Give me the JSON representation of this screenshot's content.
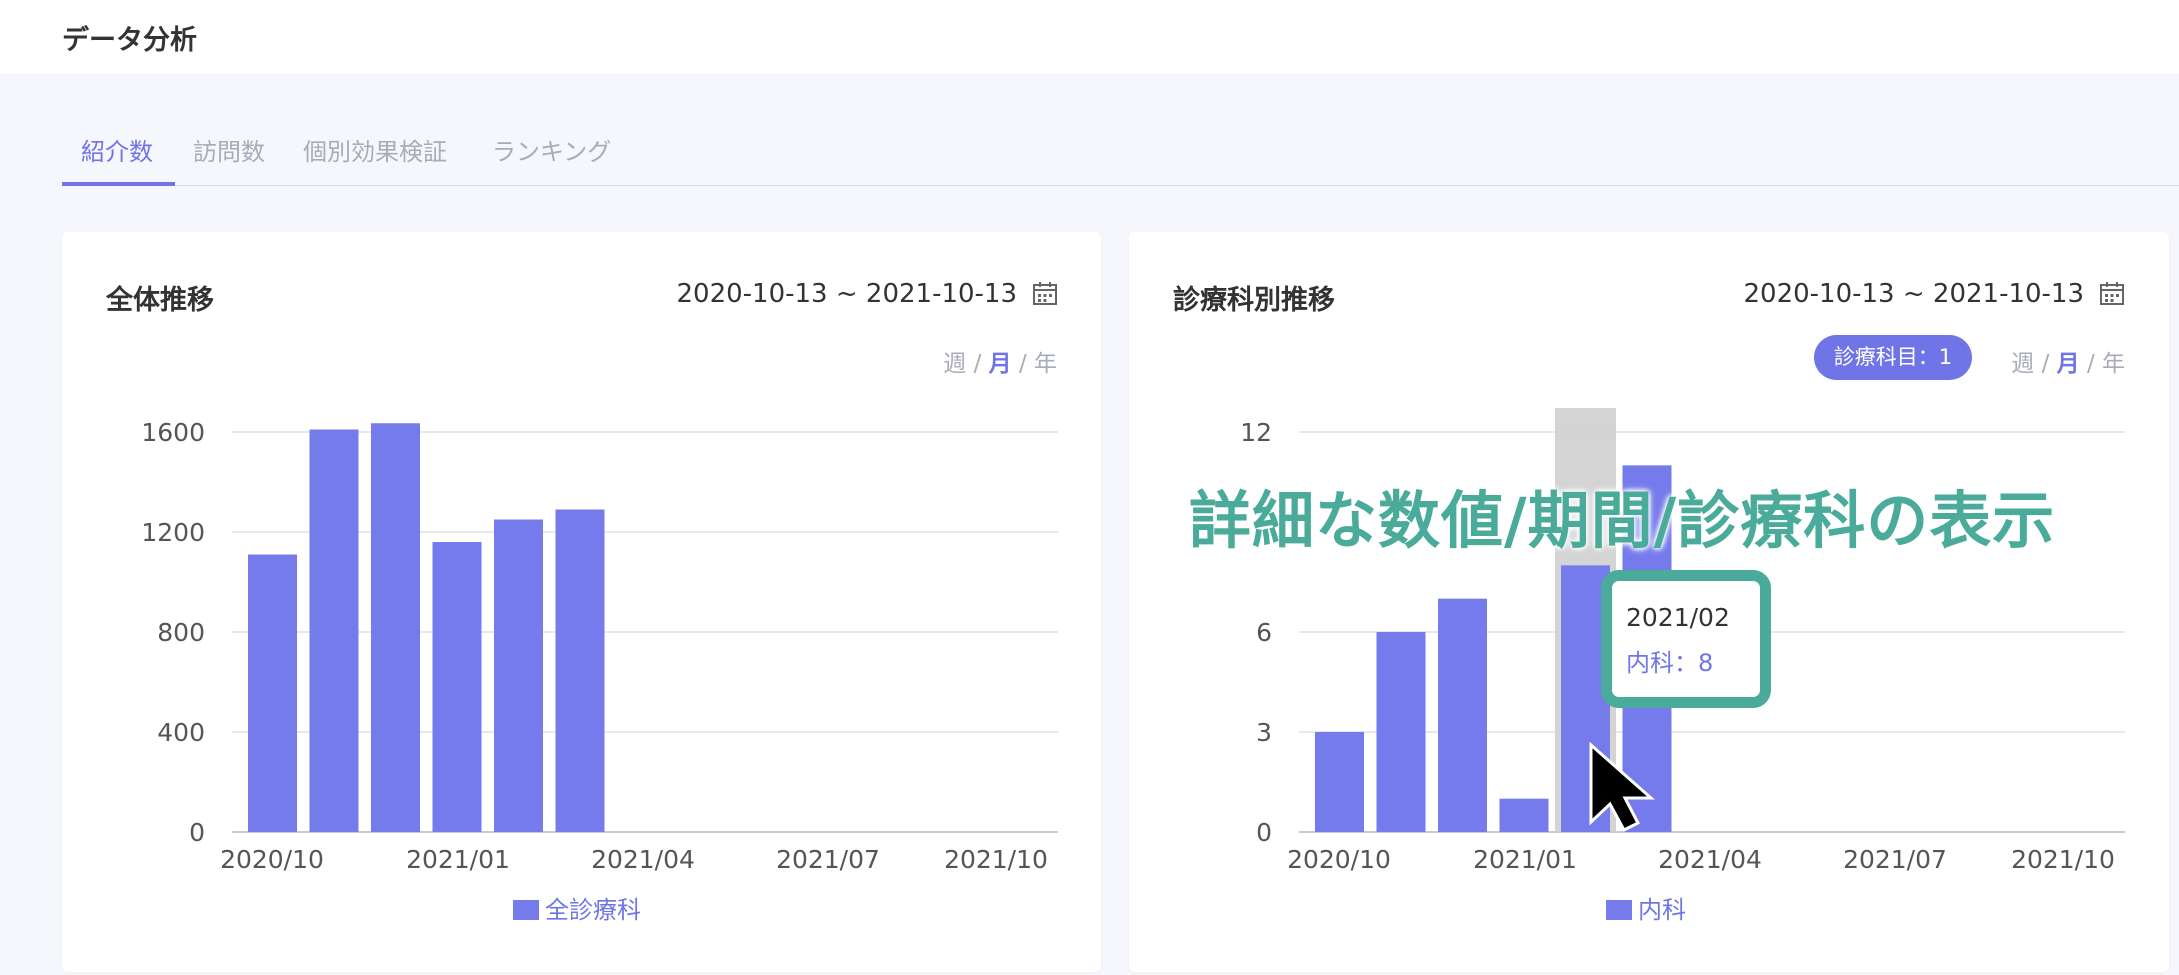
{
  "header": {
    "title": "データ分析"
  },
  "tabs": [
    {
      "label": "紹介数",
      "active": true
    },
    {
      "label": "訪問数",
      "active": false
    },
    {
      "label": "個別効果検証",
      "active": false
    },
    {
      "label": "ランキング",
      "active": false
    }
  ],
  "colors": {
    "accent": "#6f75e6",
    "bar": "#767bec",
    "highlight": "#4aab9b",
    "hover_band": "#cccccc"
  },
  "icons": {
    "date_picker": "calendar-icon",
    "pointer": "mouse-cursor-icon"
  },
  "period_options": {
    "week": "週",
    "month": "月",
    "year": "年",
    "separator": "/",
    "selected": "月"
  },
  "overall_card": {
    "title": "全体推移",
    "date_range": "2020-10-13 ~ 2021-10-13",
    "legend": "全診療科"
  },
  "department_card": {
    "title": "診療科別推移",
    "date_range": "2020-10-13 ~ 2021-10-13",
    "filter_pill": "診療科目：1",
    "legend": "内科"
  },
  "overlay": {
    "caption": "詳細な数値/期間/診療科の表示",
    "tooltip_date": "2021/02",
    "tooltip_value": "内科：8"
  },
  "chart_data": [
    {
      "type": "bar",
      "title": "全体推移",
      "categories": [
        "2020/10",
        "2020/11",
        "2020/12",
        "2021/01",
        "2021/02",
        "2021/03",
        "2021/04",
        "2021/05",
        "2021/06",
        "2021/07",
        "2021/08",
        "2021/09",
        "2021/10"
      ],
      "x_tick_labels": [
        "2020/10",
        "2021/01",
        "2021/04",
        "2021/07",
        "2021/10"
      ],
      "series": [
        {
          "name": "全診療科",
          "values": [
            1110,
            1610,
            1635,
            1160,
            1250,
            1290,
            null,
            null,
            null,
            null,
            null,
            null,
            null
          ]
        }
      ],
      "y_ticks": [
        0,
        400,
        800,
        1200,
        1600
      ],
      "ylim": [
        0,
        1600
      ],
      "grid": true,
      "legend_position": "bottom"
    },
    {
      "type": "bar",
      "title": "診療科別推移",
      "categories": [
        "2020/10",
        "2020/11",
        "2020/12",
        "2021/01",
        "2021/02",
        "2021/03",
        "2021/04",
        "2021/05",
        "2021/06",
        "2021/07",
        "2021/08",
        "2021/09",
        "2021/10"
      ],
      "x_tick_labels": [
        "2020/10",
        "2021/01",
        "2021/04",
        "2021/07",
        "2021/10"
      ],
      "series": [
        {
          "name": "内科",
          "values": [
            3,
            6,
            7,
            1,
            8,
            11,
            null,
            null,
            null,
            null,
            null,
            null,
            null
          ]
        }
      ],
      "y_ticks": [
        0,
        3,
        6,
        12
      ],
      "ylim": [
        0,
        12
      ],
      "grid": true,
      "legend_position": "bottom",
      "hovered_category": "2021/02"
    }
  ]
}
